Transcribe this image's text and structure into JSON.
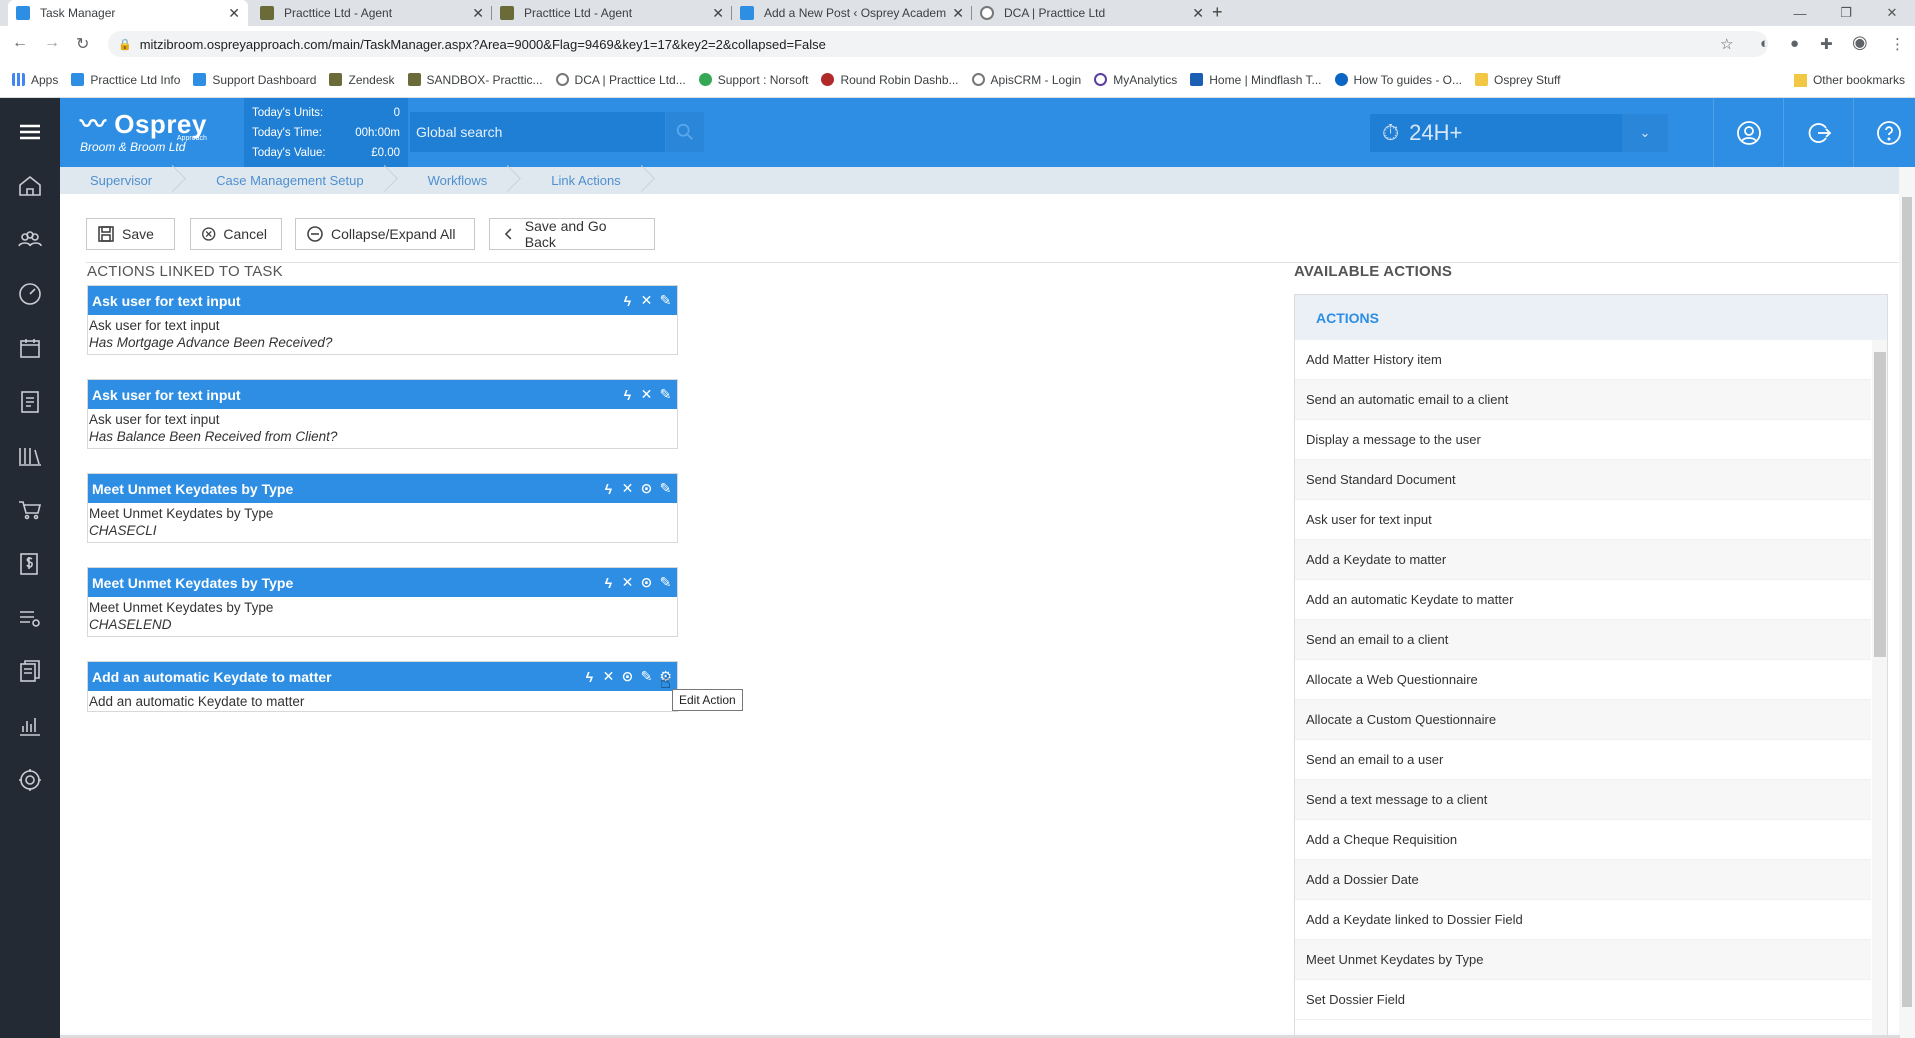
{
  "browser": {
    "tabs": [
      {
        "title": "Task Manager",
        "color": "#2d8ee3"
      },
      {
        "title": "Practtice Ltd - Agent",
        "color": "#6b6b3a"
      },
      {
        "title": "Practtice Ltd - Agent",
        "color": "#6b6b3a"
      },
      {
        "title": "Add a New Post ‹ Osprey Academ",
        "color": "#2d8ee3"
      },
      {
        "title": "DCA | Practtice Ltd",
        "color": "#777777"
      }
    ],
    "url": "mitzibroom.ospreyapproach.com/main/TaskManager.aspx?Area=9000&Flag=9469&key1=17&key2=2&collapsed=False",
    "bookmarks": [
      "Apps",
      "Practtice Ltd Info",
      "Support Dashboard",
      "Zendesk",
      "SANDBOX- Practtic...",
      "DCA | Practtice Ltd...",
      "Support : Norsoft",
      "Round Robin Dashb...",
      "ApisCRM - Login",
      "MyAnalytics",
      "Home | Mindflash T...",
      "How To guides - O...",
      "Osprey Stuff"
    ],
    "other_bookmarks": "Other bookmarks"
  },
  "app": {
    "brand": "Osprey",
    "brand_small": "Approach",
    "firm": "Broom & Broom Ltd",
    "stats": [
      {
        "label": "Today's Units:",
        "value": "0"
      },
      {
        "label": "Today's Time:",
        "value": "00h:00m"
      },
      {
        "label": "Today's Value:",
        "value": "£0.00"
      }
    ],
    "search_placeholder": "Global search",
    "timer": "24H+",
    "breadcrumbs": [
      "Supervisor",
      "Case Management Setup",
      "Workflows",
      "Link Actions"
    ]
  },
  "toolbar": {
    "save": "Save",
    "cancel": "Cancel",
    "collapse": "Collapse/Expand All",
    "save_back": "Save and Go Back"
  },
  "linked": {
    "title": "ACTIONS LINKED TO TASK",
    "cards": [
      {
        "head": "Ask user for text input",
        "line1": "Ask user for text input",
        "line2": "Has Mortgage Advance Been Received?"
      },
      {
        "head": "Ask user for text input",
        "line1": "Ask user for text input",
        "line2": "Has Balance Been Received from Client?"
      },
      {
        "head": "Meet Unmet Keydates by Type",
        "line1": "Meet Unmet Keydates by Type",
        "line2": "CHASECLI"
      },
      {
        "head": "Meet Unmet Keydates by Type",
        "line1": "Meet Unmet Keydates by Type",
        "line2": "CHASELEND"
      },
      {
        "head": "Add an automatic Keydate to matter",
        "line1": "Add an automatic Keydate to matter",
        "line2": ""
      }
    ],
    "tooltip": "Edit Action"
  },
  "available": {
    "title": "AVAILABLE ACTIONS",
    "header": "ACTIONS",
    "items": [
      "Add Matter History item",
      "Send an automatic email to a client",
      "Display a message to the user",
      "Send Standard Document",
      "Ask user for text input",
      "Add a Keydate to matter",
      "Add an automatic Keydate to matter",
      "Send an email to a client",
      "Allocate a Web Questionnaire",
      "Allocate a Custom Questionnaire",
      "Send an email to a user",
      "Send a text message to a client",
      "Add a Cheque Requisition",
      "Add a Dossier Date",
      "Add a Keydate linked to Dossier Field",
      "Meet Unmet Keydates by Type",
      "Set Dossier Field"
    ]
  }
}
